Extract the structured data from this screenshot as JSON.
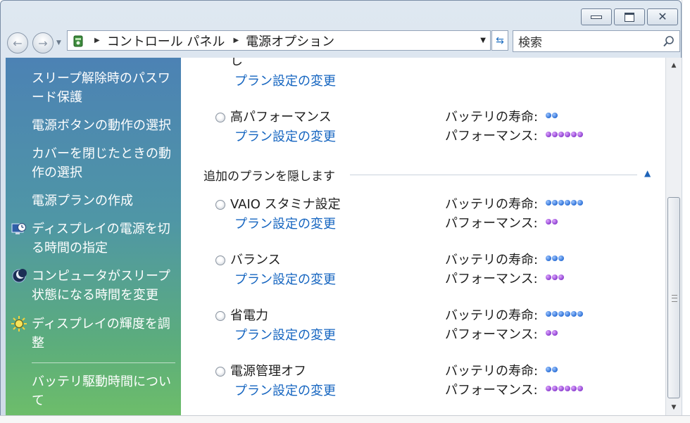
{
  "window": {
    "controls": {
      "minimize": "minimize",
      "maximize": "maximize",
      "close": "close"
    }
  },
  "address_bar": {
    "breadcrumbs": [
      "コントロール パネル",
      "電源オプション"
    ]
  },
  "search": {
    "placeholder": "検索"
  },
  "sidebar": {
    "items": [
      {
        "label": "スリープ解除時のパスワード保護",
        "icon": null
      },
      {
        "label": "電源ボタンの動作の選択",
        "icon": null
      },
      {
        "label": "カバーを閉じたときの動作の選択",
        "icon": null
      },
      {
        "label": "電源プランの作成",
        "icon": null
      },
      {
        "label": "ディスプレイの電源を切る時間の指定",
        "icon": "monitor-clock-icon"
      },
      {
        "label": "コンピュータがスリープ状態になる時間を変更",
        "icon": "moon-icon"
      },
      {
        "label": "ディスプレイの輝度を調整",
        "icon": "brightness-sun-icon"
      }
    ],
    "footer_item": "バッテリ駆動時間につい\nて"
  },
  "content": {
    "truncated_top_text": "し",
    "change_link": "プラン設定の変更",
    "battery_label": "バッテリの寿命:",
    "performance_label": "パフォーマンス:",
    "hidden_group_header": "追加のプランを隠します",
    "plans": [
      {
        "name": "高パフォーマンス",
        "battery": 2,
        "performance": 6
      },
      {
        "name": "VAIO スタミナ設定",
        "battery": 6,
        "performance": 2
      },
      {
        "name": "バランス",
        "battery": 3,
        "performance": 3
      },
      {
        "name": "省電力",
        "battery": 6,
        "performance": 2
      },
      {
        "name": "電源管理オフ",
        "battery": 2,
        "performance": 6
      }
    ],
    "colors": {
      "link": "#1565c0",
      "battery_dot": "#2b6fd6",
      "performance_dot": "#8b3fcf"
    }
  }
}
